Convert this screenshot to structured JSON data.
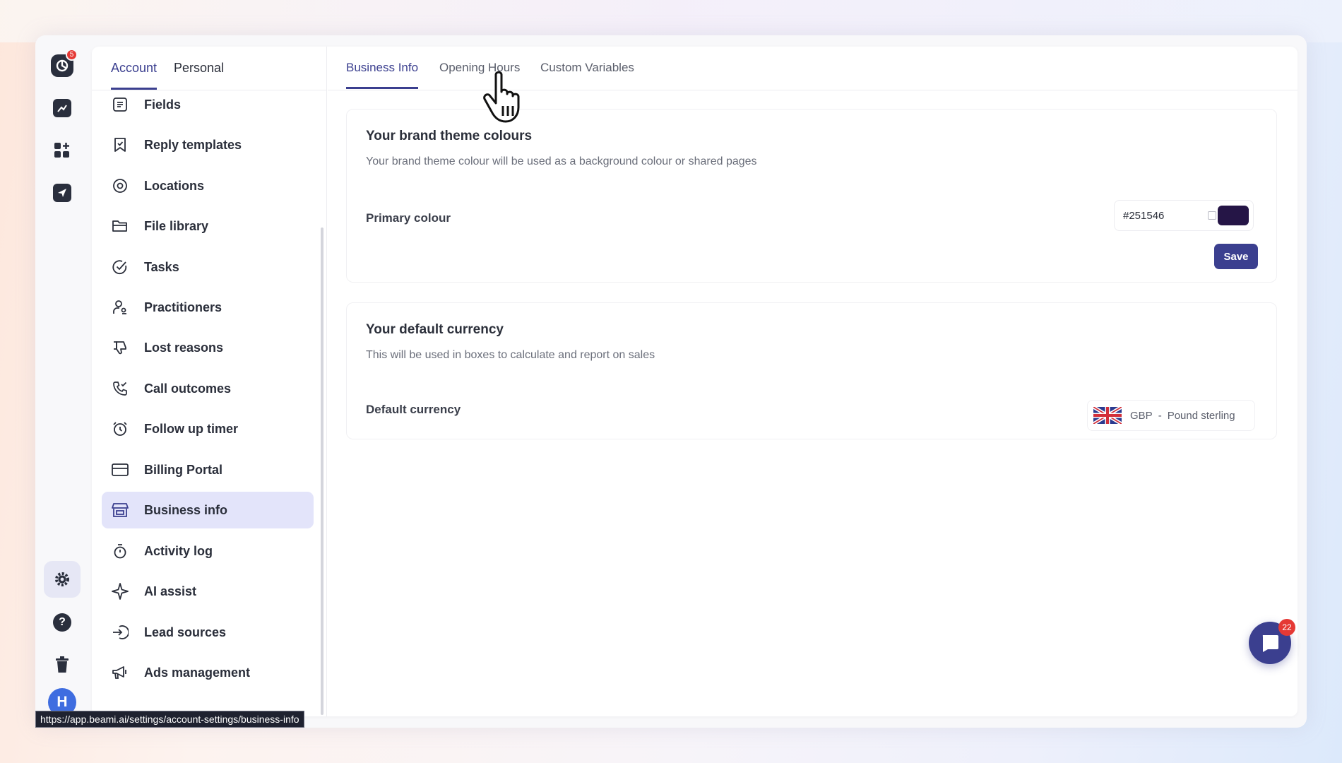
{
  "rail": {
    "logo_badge": "5",
    "avatar_initial": "H",
    "icons": [
      "logo-icon",
      "analytics-icon",
      "apps-icon",
      "send-icon",
      "settings-icon",
      "help-icon",
      "trash-icon"
    ]
  },
  "sidebar": {
    "tabs": [
      {
        "label": "Account",
        "active": true
      },
      {
        "label": "Personal",
        "active": false
      }
    ],
    "items": [
      {
        "label": "Fields",
        "icon": "fields-icon"
      },
      {
        "label": "Reply templates",
        "icon": "bookmark-icon"
      },
      {
        "label": "Locations",
        "icon": "location-icon"
      },
      {
        "label": "File library",
        "icon": "folder-icon"
      },
      {
        "label": "Tasks",
        "icon": "task-check-icon"
      },
      {
        "label": "Practitioners",
        "icon": "practitioner-icon"
      },
      {
        "label": "Lost reasons",
        "icon": "thumbs-down-icon"
      },
      {
        "label": "Call outcomes",
        "icon": "phone-check-icon"
      },
      {
        "label": "Follow up timer",
        "icon": "alarm-clock-icon"
      },
      {
        "label": "Billing Portal",
        "icon": "credit-card-icon"
      },
      {
        "label": "Business info",
        "icon": "store-icon",
        "active": true
      },
      {
        "label": "Activity log",
        "icon": "stopwatch-icon"
      },
      {
        "label": "AI assist",
        "icon": "sparkle-icon"
      },
      {
        "label": "Lead sources",
        "icon": "sign-in-icon"
      },
      {
        "label": "Ads management",
        "icon": "megaphone-icon"
      }
    ]
  },
  "main": {
    "tabs": [
      {
        "label": "Business Info",
        "active": true
      },
      {
        "label": "Opening Hours",
        "active": false
      },
      {
        "label": "Custom Variables",
        "active": false
      }
    ],
    "brand": {
      "title": "Your brand theme colours",
      "description": "Your brand theme colour will be used as a background colour or shared pages",
      "primary_label": "Primary colour",
      "primary_value": "#251546",
      "swatch_color": "#251546",
      "save_label": "Save"
    },
    "currency": {
      "title": "Your default currency",
      "description": "This will be used in boxes to calculate and report on sales",
      "label": "Default currency",
      "code": "GBP",
      "separator": "-",
      "name": "Pound sterling"
    }
  },
  "chat": {
    "badge": "22"
  },
  "status_url": "https://app.beami.ai/settings/account-settings/business-info",
  "colors": {
    "accent": "#3b3f8f",
    "active_item_bg": "#e3e4fa",
    "badge": "#e53935"
  }
}
